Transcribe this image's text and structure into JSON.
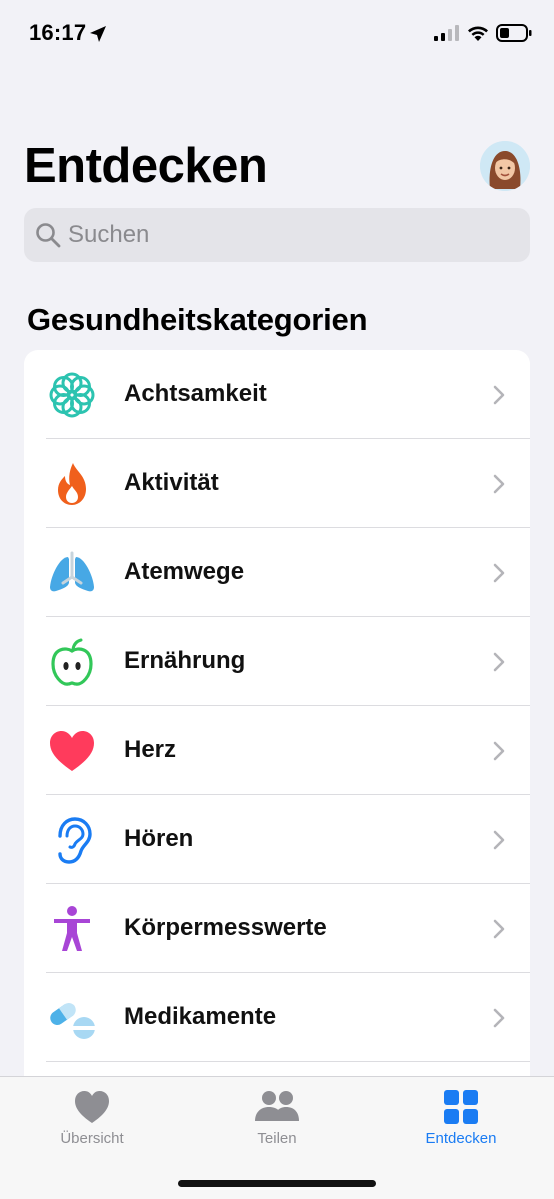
{
  "status_bar": {
    "time": "16:17"
  },
  "header": {
    "title": "Entdecken"
  },
  "search": {
    "placeholder": "Suchen"
  },
  "section": {
    "title": "Gesundheitskategorien"
  },
  "categories": [
    {
      "label": "Achtsamkeit",
      "icon": "mindfulness-icon",
      "color": "#2cc3b0"
    },
    {
      "label": "Aktivität",
      "icon": "flame-icon",
      "color": "#f0601c"
    },
    {
      "label": "Atemwege",
      "icon": "lungs-icon",
      "color": "#47a8e5"
    },
    {
      "label": "Ernährung",
      "icon": "apple-icon",
      "color": "#32c759"
    },
    {
      "label": "Herz",
      "icon": "heart-icon",
      "color": "#ff3b5c"
    },
    {
      "label": "Hören",
      "icon": "ear-icon",
      "color": "#1a7cf3"
    },
    {
      "label": "Körpermesswerte",
      "icon": "body-figure-icon",
      "color": "#a845d6"
    },
    {
      "label": "Medikamente",
      "icon": "pills-icon",
      "color": "#4db1e8"
    }
  ],
  "tabbar": {
    "tabs": [
      {
        "label": "Übersicht",
        "icon": "heart-icon",
        "active": false
      },
      {
        "label": "Teilen",
        "icon": "people-icon",
        "active": false
      },
      {
        "label": "Entdecken",
        "icon": "grid-icon",
        "active": true
      }
    ],
    "active_color": "#1a7cf3",
    "inactive_color": "#8e8e93"
  }
}
